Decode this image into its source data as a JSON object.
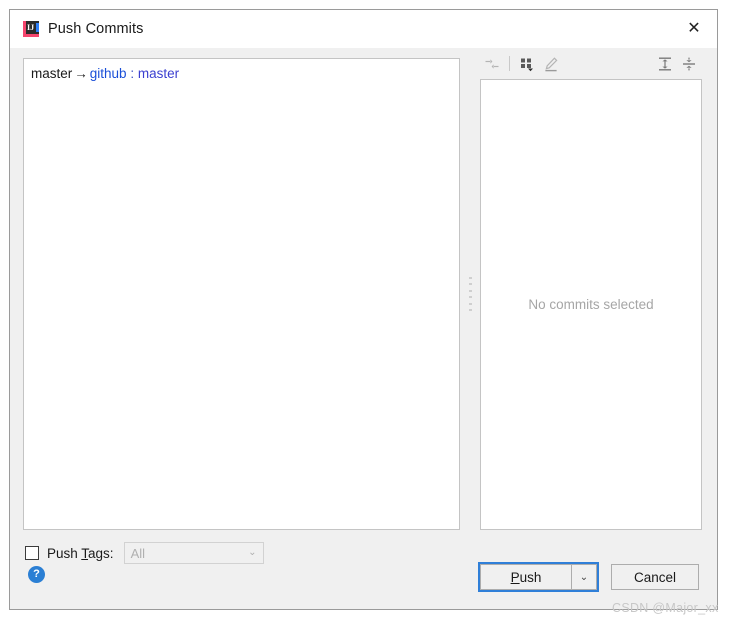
{
  "window": {
    "title": "Push Commits",
    "app_icon": "intellij-idea-icon",
    "close_label": "✕"
  },
  "left_panel": {
    "branch_row": {
      "local_branch": "master",
      "arrow": "→",
      "remote_name": "github",
      "separator": ":",
      "remote_branch": "master"
    }
  },
  "toolbar": {
    "buttons": [
      {
        "name": "collapse-arrows-icon",
        "tooltip": "Show Diff"
      },
      {
        "name": "group-by-icon",
        "tooltip": "Group By"
      },
      {
        "name": "edit-pencil-icon",
        "tooltip": "Edit"
      },
      {
        "name": "expand-all-icon",
        "tooltip": "Expand All"
      },
      {
        "name": "collapse-all-icon",
        "tooltip": "Collapse All"
      }
    ]
  },
  "right_panel": {
    "empty_message": "No commits selected"
  },
  "options": {
    "push_tags": {
      "label_before": "Push ",
      "label_mnemonic": "T",
      "label_after": "ags:",
      "checked": false,
      "combo_value": "All",
      "combo_arrow": "⌄",
      "combo_enabled": false
    }
  },
  "footer": {
    "help_label": "?",
    "push_label_before": "",
    "push_mnemonic": "P",
    "push_label_after": "ush",
    "push_split_arrow": "⌄",
    "cancel_label": "Cancel"
  },
  "watermark": {
    "text": "CSDN @Major_xx"
  },
  "colors": {
    "accent_blue": "#2f7fd8",
    "link_blue": "#1a4fd8",
    "help_blue": "#2b7fd4",
    "dialog_bg": "#f0f0f0",
    "panel_bg": "#ffffff",
    "muted_text": "#a6a6a6"
  }
}
